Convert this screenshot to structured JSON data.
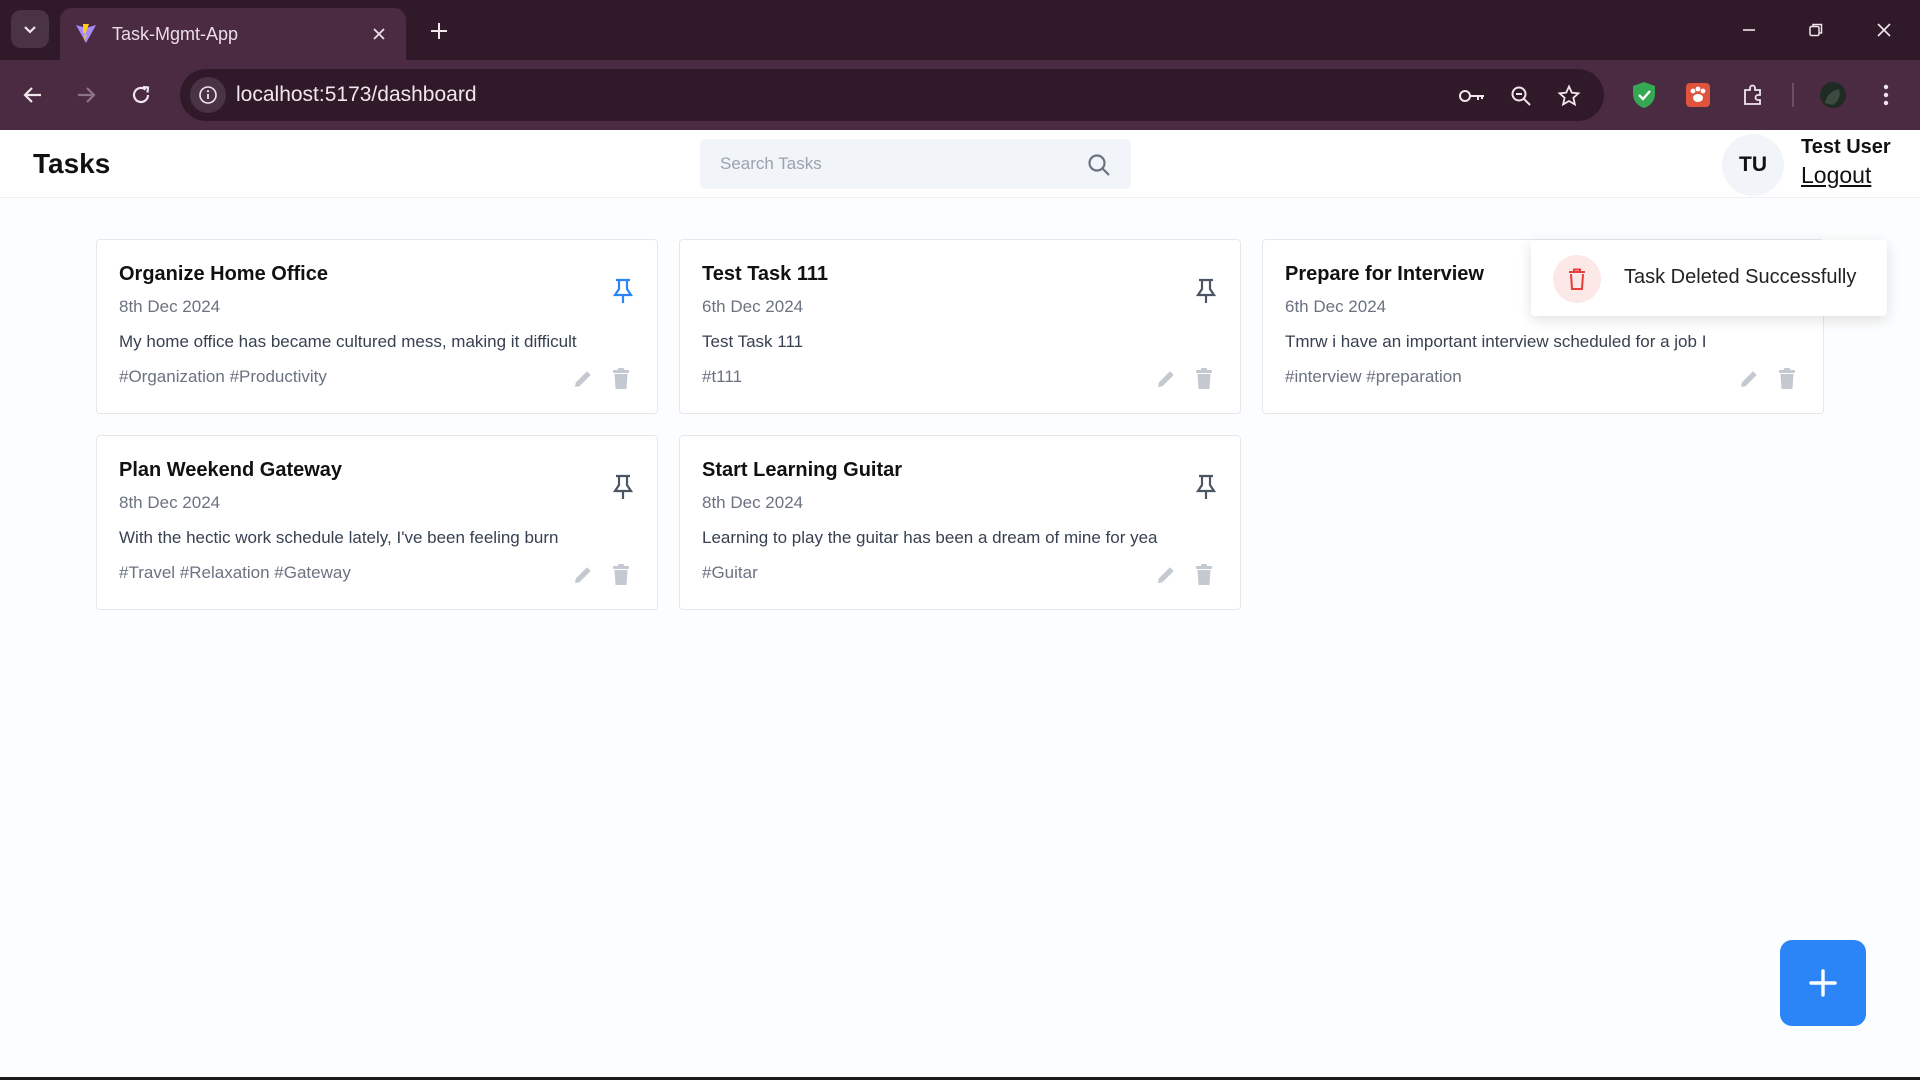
{
  "browser": {
    "tab_title": "Task-Mgmt-App",
    "url": "localhost:5173/dashboard"
  },
  "header": {
    "title": "Tasks",
    "search_placeholder": "Search Tasks",
    "avatar_initials": "TU",
    "user_name": "Test User",
    "logout_label": "Logout"
  },
  "tasks": [
    {
      "title": "Organize Home Office",
      "date": "8th Dec 2024",
      "description": "My home office has became cultured mess, making it difficult",
      "tags": "#Organization #Productivity",
      "pinned": true
    },
    {
      "title": "Test Task 111",
      "date": "6th Dec 2024",
      "description": "Test Task 111",
      "tags": "#t111",
      "pinned": false
    },
    {
      "title": "Prepare for Interview",
      "date": "6th Dec 2024",
      "description": "Tmrw i have an important interview scheduled for a job I",
      "tags": "#interview #preparation",
      "pinned": false
    },
    {
      "title": "Plan Weekend Gateway",
      "date": "8th Dec 2024",
      "description": "With the hectic work schedule lately, I've been feeling burn",
      "tags": "#Travel #Relaxation #Gateway",
      "pinned": false
    },
    {
      "title": "Start Learning Guitar",
      "date": "8th Dec 2024",
      "description": "Learning to play the guitar has been a dream of mine for yea",
      "tags": "#Guitar",
      "pinned": false
    }
  ],
  "toast": {
    "message": "Task Deleted Successfully"
  },
  "icons": {
    "fab": "plus-icon",
    "pin": "pin-icon",
    "edit": "pencil-icon",
    "delete": "trash-icon"
  },
  "colors": {
    "accent": "#2b85f7",
    "pin_active": "#2b85f7",
    "pin_inactive": "#4b5563",
    "muted_icon": "#c4c9d1",
    "toast_icon": "#e53e3e",
    "chrome_dark": "#301a2a",
    "chrome_mid": "#4a2b41"
  }
}
